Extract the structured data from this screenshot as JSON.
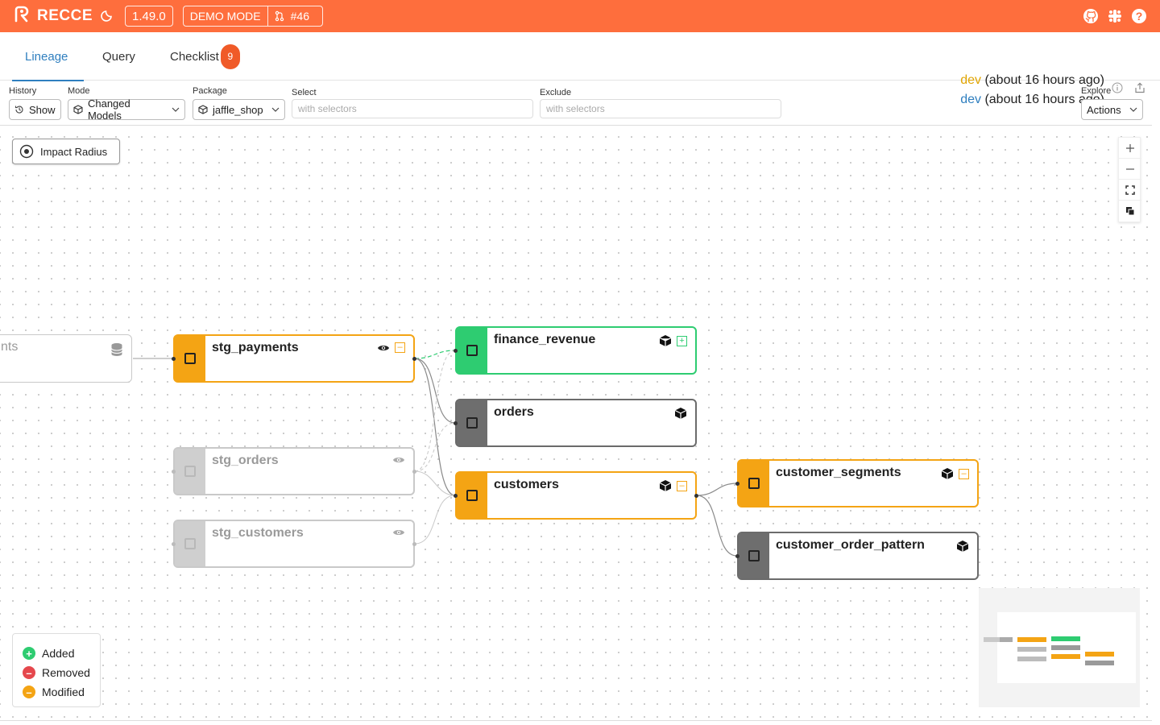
{
  "app": {
    "name": "RECCE",
    "version": "1.49.0",
    "mode_label": "DEMO MODE",
    "pr_label": "#46"
  },
  "tabs": [
    {
      "label": "Lineage",
      "active": true
    },
    {
      "label": "Query",
      "active": false
    },
    {
      "label": "Checklist",
      "active": false,
      "badge": "9"
    }
  ],
  "env": {
    "base_name": "dev",
    "base_time": "(about 16 hours ago)",
    "current_name": "dev",
    "current_time": "(about 16 hours ago)"
  },
  "filters": {
    "history_label": "History",
    "history_value": "Show",
    "mode_label": "Mode",
    "mode_value": "Changed Models",
    "package_label": "Package",
    "package_value": "jaffle_shop",
    "select_label": "Select",
    "select_placeholder": "with selectors",
    "exclude_label": "Exclude",
    "exclude_placeholder": "with selectors",
    "explore_label": "Explore",
    "explore_value": "Actions"
  },
  "impact_radius_label": "Impact Radius",
  "nodes": {
    "payments_src": "nts",
    "stg_payments": "stg_payments",
    "stg_orders": "stg_orders",
    "stg_customers": "stg_customers",
    "finance_revenue": "finance_revenue",
    "orders": "orders",
    "customers": "customers",
    "customer_segments": "customer_segments",
    "customer_order_pattern": "customer_order_pattern"
  },
  "node_status": {
    "stg_payments": "modified",
    "stg_orders": "unchanged-dimmed",
    "stg_customers": "unchanged-dimmed",
    "finance_revenue": "added",
    "orders": "unchanged",
    "customers": "modified",
    "customer_segments": "modified",
    "customer_order_pattern": "unchanged"
  },
  "legend": {
    "added": "Added",
    "removed": "Removed",
    "modified": "Modified"
  },
  "colors": {
    "topbar": "#fe6e3d",
    "added": "#2ecc71",
    "removed": "#e5484d",
    "modified": "#f4a414",
    "unchanged": "#6e6e6e",
    "active_tab": "#2f7fbf"
  }
}
